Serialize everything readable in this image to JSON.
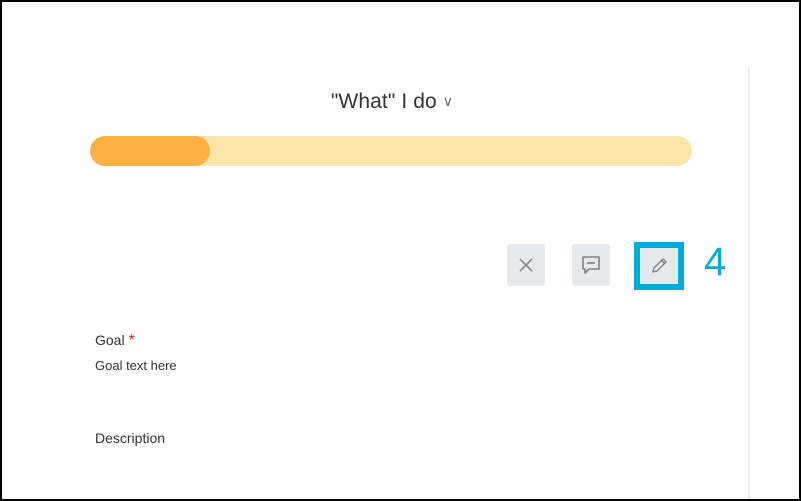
{
  "section": {
    "title": "\"What\" I do",
    "chevron_icon": "chevron-down-icon"
  },
  "progress": {
    "percent": 20,
    "fill_color": "#fbb040",
    "track_color": "#fbe4a8"
  },
  "toolbar": {
    "close_icon": "close-icon",
    "comment_icon": "comment-icon",
    "edit_icon": "pencil-icon",
    "highlight_color": "#00aadd"
  },
  "callout": {
    "number": "4"
  },
  "fields": {
    "goal": {
      "label": "Goal",
      "required_mark": "*",
      "value": "Goal text here"
    },
    "description": {
      "label": "Description"
    }
  }
}
